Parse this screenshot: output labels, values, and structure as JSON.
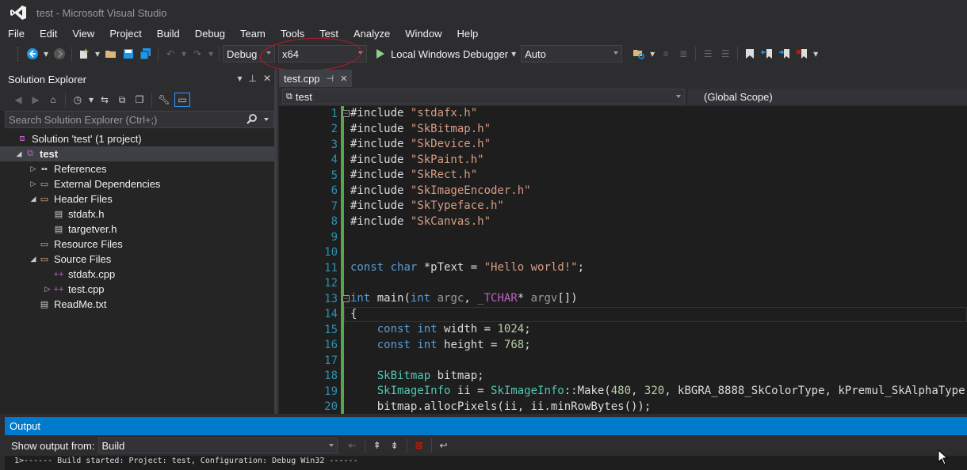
{
  "window": {
    "title": "test - Microsoft Visual Studio"
  },
  "menu": [
    "File",
    "Edit",
    "View",
    "Project",
    "Build",
    "Debug",
    "Team",
    "Tools",
    "Test",
    "Analyze",
    "Window",
    "Help"
  ],
  "toolbar": {
    "configuration": "Debug",
    "platform": "x64",
    "debugger_label": "Local Windows Debugger",
    "solution_config": "Auto"
  },
  "solution_explorer": {
    "title": "Solution Explorer",
    "search_placeholder": "Search Solution Explorer (Ctrl+;)",
    "items": [
      {
        "label": "Solution 'test' (1 project)",
        "level": 0,
        "expander": "",
        "icon": "solution-icon"
      },
      {
        "label": "test",
        "level": 0,
        "expander": "expanded",
        "icon": "project-icon",
        "bold": true,
        "selected": true
      },
      {
        "label": "References",
        "level": 1,
        "expander": "collapsed",
        "icon": "references-icon"
      },
      {
        "label": "External Dependencies",
        "level": 1,
        "expander": "collapsed",
        "icon": "folder-icon"
      },
      {
        "label": "Header Files",
        "level": 1,
        "expander": "expanded",
        "icon": "folder-icon"
      },
      {
        "label": "stdafx.h",
        "level": 2,
        "expander": "",
        "icon": "header-file-icon"
      },
      {
        "label": "targetver.h",
        "level": 2,
        "expander": "",
        "icon": "header-file-icon"
      },
      {
        "label": "Resource Files",
        "level": 1,
        "expander": "",
        "icon": "folder-icon"
      },
      {
        "label": "Source Files",
        "level": 1,
        "expander": "expanded",
        "icon": "folder-icon"
      },
      {
        "label": "stdafx.cpp",
        "level": 2,
        "expander": "",
        "icon": "cpp-file-icon"
      },
      {
        "label": "test.cpp",
        "level": 2,
        "expander": "collapsed",
        "icon": "cpp-file-icon"
      },
      {
        "label": "ReadMe.txt",
        "level": 1,
        "expander": "",
        "icon": "text-file-icon"
      }
    ]
  },
  "editor": {
    "tab_name": "test.cpp",
    "project_scope": "test",
    "global_scope": "(Global Scope)",
    "line_numbers": [
      "1",
      "2",
      "3",
      "4",
      "5",
      "6",
      "7",
      "8",
      "9",
      "10",
      "11",
      "12",
      "13",
      "14",
      "15",
      "16",
      "17",
      "18",
      "19",
      "20"
    ],
    "lines": [
      "#include \"stdafx.h\"",
      "#include \"SkBitmap.h\"",
      "#include \"SkDevice.h\"",
      "#include \"SkPaint.h\"",
      "#include \"SkRect.h\"",
      "#include \"SkImageEncoder.h\"",
      "#include \"SkTypeface.h\"",
      "#include \"SkCanvas.h\"",
      "",
      "",
      "const char *pText = \"Hello world!\";",
      "",
      "int main(int argc, _TCHAR* argv[])",
      "{",
      "    const int width = 1024;",
      "    const int height = 768;",
      "",
      "    SkBitmap bitmap;",
      "    SkImageInfo ii = SkImageInfo::Make(480, 320, kBGRA_8888_SkColorType, kPremul_SkAlphaType",
      "    bitmap.allocPixels(ii, ii.minRowBytes());"
    ]
  },
  "output": {
    "title": "Output",
    "show_from_label": "Show output from:",
    "source": "Build",
    "text": "1>------ Build started: Project: test, Configuration: Debug Win32 ------"
  },
  "colors": {
    "accent": "#007acc",
    "annotation": "#c8142a"
  }
}
